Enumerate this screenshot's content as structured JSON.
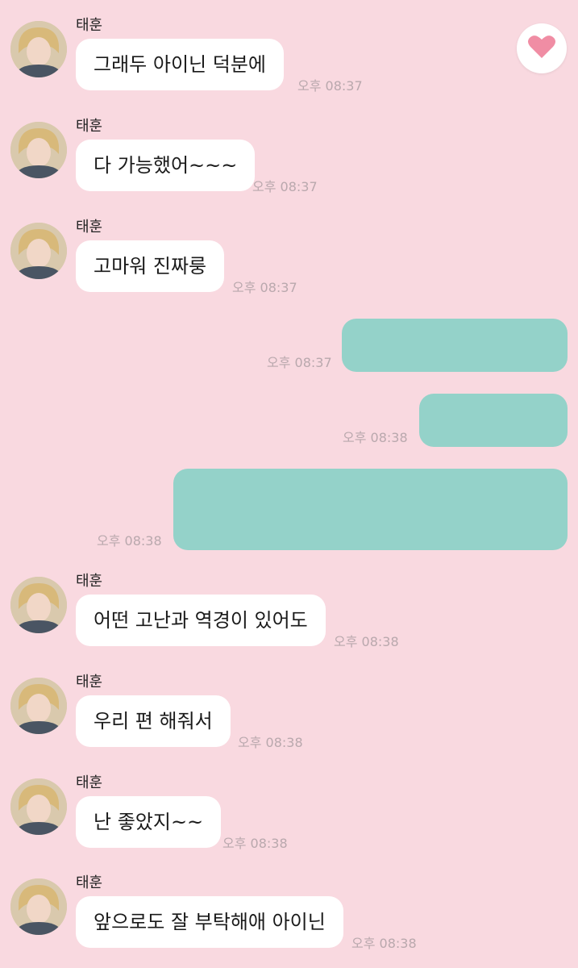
{
  "sender_name": "태훈",
  "messages_in": [
    {
      "text": "그래두 아이닌 덕분에",
      "time": "오후 08:37"
    },
    {
      "text": "다 가능했어~~~",
      "time": "오후 08:37"
    },
    {
      "text": "고마워 진짜룽",
      "time": "오후 08:37"
    },
    {
      "text": "어떤 고난과 역경이 있어도",
      "time": "오후 08:38"
    },
    {
      "text": "우리 편 해줘서",
      "time": "오후 08:38"
    },
    {
      "text": "난 좋았지~~",
      "time": "오후 08:38"
    },
    {
      "text": "앞으로도 잘 부탁해애 아이닌",
      "time": "오후 08:38"
    }
  ],
  "messages_out": [
    {
      "time": "오후 08:37"
    },
    {
      "time": "오후 08:38"
    },
    {
      "time": "오후 08:38"
    }
  ],
  "colors": {
    "background": "#f9d9e0",
    "incoming_bubble": "#ffffff",
    "outgoing_bubble": "#94d2c9",
    "timestamp": "#b9a8ad",
    "heart": "#f08da4"
  },
  "icons": {
    "reaction": "heart-icon",
    "avatar": "profile-photo"
  }
}
